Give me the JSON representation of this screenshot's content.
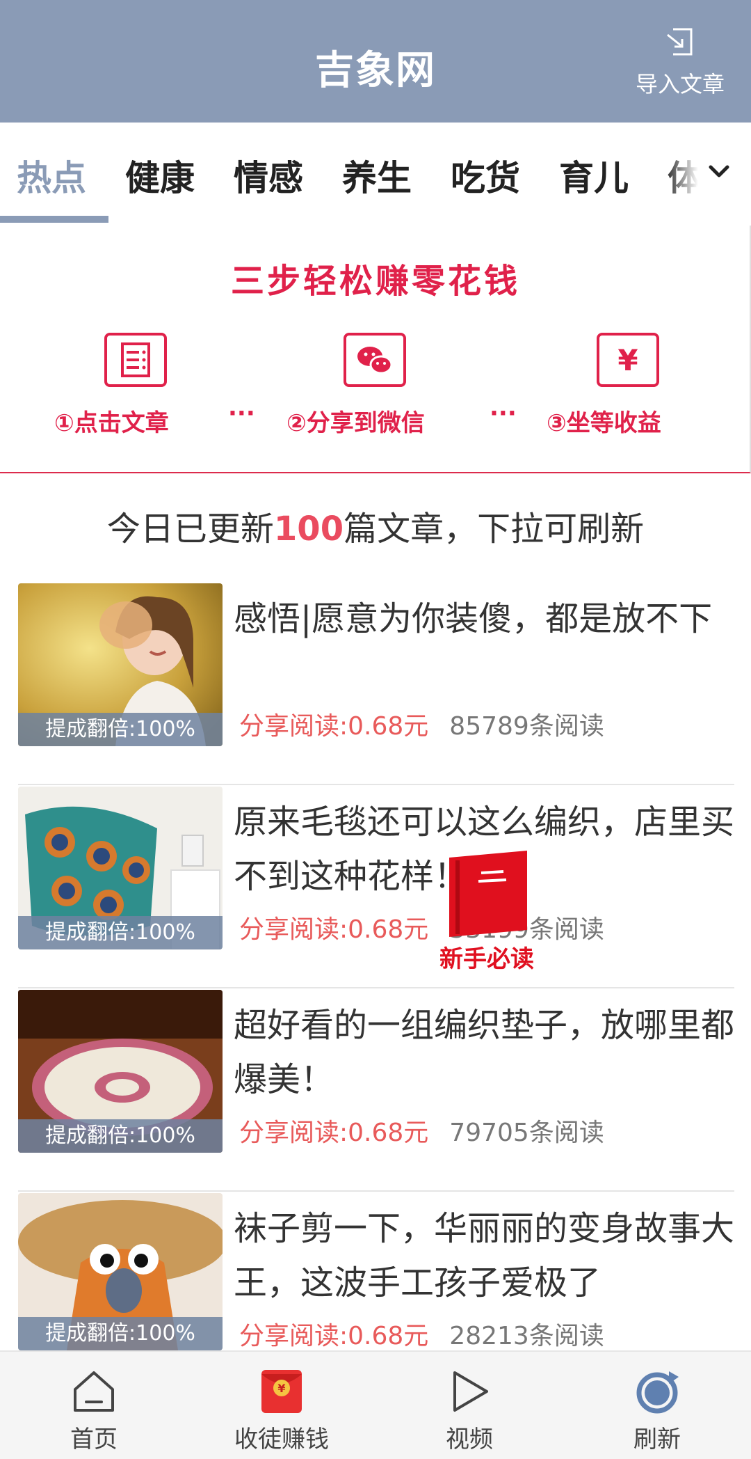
{
  "header": {
    "title": "吉象网",
    "import_label": "导入文章",
    "import_icon": "import-icon"
  },
  "tabs": {
    "items": [
      {
        "label": "热点",
        "active": true
      },
      {
        "label": "健康",
        "active": false
      },
      {
        "label": "情感",
        "active": false
      },
      {
        "label": "养生",
        "active": false
      },
      {
        "label": "吃货",
        "active": false
      },
      {
        "label": "育儿",
        "active": false
      },
      {
        "label": "体",
        "active": false
      }
    ],
    "more_icon": "chevron-down-icon"
  },
  "banner": {
    "title": "三步轻松赚零花钱",
    "steps": [
      {
        "label": "①点击文章",
        "icon": "article-icon"
      },
      {
        "label": "②分享到微信",
        "icon": "wechat-icon"
      },
      {
        "label": "③坐等收益",
        "icon": "yuan-icon"
      }
    ],
    "separator": "···"
  },
  "update": {
    "prefix": "今日已更新",
    "count": "100",
    "suffix": "篇文章，下拉可刷新"
  },
  "articles": [
    {
      "title": "感悟|愿意为你装傻，都是放不下",
      "badge": "提成翻倍:100%",
      "pay": "分享阅读:0.68元",
      "reads": "85789条阅读"
    },
    {
      "title": "原来毛毯还可以这么编织，店里买不到这种花样！",
      "badge": "提成翻倍:100%",
      "pay": "分享阅读:0.68元",
      "reads": "33199条阅读"
    },
    {
      "title": "超好看的一组编织垫子，放哪里都爆美！",
      "badge": "提成翻倍:100%",
      "pay": "分享阅读:0.68元",
      "reads": "79705条阅读"
    },
    {
      "title": "袜子剪一下，华丽丽的变身故事大王，这波手工孩子爱极了",
      "badge": "提成翻倍:100%",
      "pay": "分享阅读:0.68元",
      "reads": "28213条阅读"
    }
  ],
  "float_badge": {
    "label": "新手必读",
    "icon": "book-icon"
  },
  "bottom_nav": {
    "items": [
      {
        "label": "首页",
        "icon": "home-icon"
      },
      {
        "label": "收徒赚钱",
        "icon": "red-envelope-icon"
      },
      {
        "label": "视频",
        "icon": "play-icon"
      },
      {
        "label": "刷新",
        "icon": "refresh-icon"
      }
    ]
  },
  "colors": {
    "header_bg": "#8a9bb6",
    "accent_red": "#e0214a",
    "pay_red": "#e85a5a"
  }
}
